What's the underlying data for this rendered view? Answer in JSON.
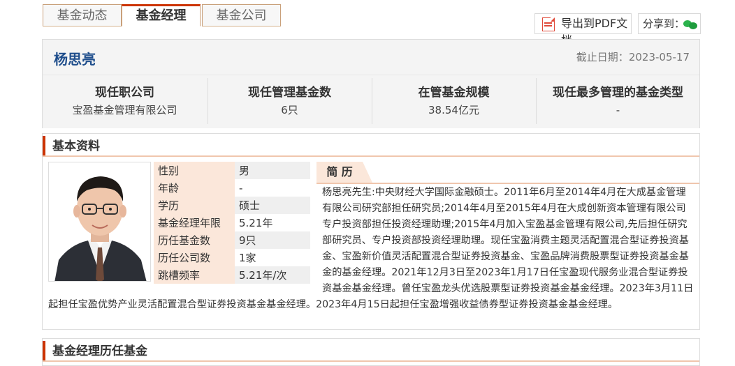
{
  "tabs": [
    {
      "label": "基金动态",
      "active": false
    },
    {
      "label": "基金经理",
      "active": true
    },
    {
      "label": "基金公司",
      "active": false
    }
  ],
  "toolbar": {
    "export_label": "导出到PDF文档",
    "share_label": "分享到：",
    "share_icon": "wechat-icon",
    "export_icon": "pdf-icon"
  },
  "manager": {
    "name": "杨思亮",
    "deadline_label": "截止日期：",
    "deadline": "2023-05-17"
  },
  "stats": [
    {
      "label": "现任职公司",
      "value": "宝盈基金管理有限公司"
    },
    {
      "label": "现任管理基金数",
      "value": "6只"
    },
    {
      "label": "在管基金规模",
      "value": "38.54亿元"
    },
    {
      "label": "现任最多管理的基金类型",
      "value": "-"
    }
  ],
  "basic_info": {
    "title": "基本资料",
    "attributes": [
      {
        "key": "性别",
        "value": "男"
      },
      {
        "key": "年龄",
        "value": "-"
      },
      {
        "key": "学历",
        "value": "硕士"
      },
      {
        "key": "基金经理年限",
        "value": "5.21年"
      },
      {
        "key": "历任基金数",
        "value": "9只"
      },
      {
        "key": "历任公司数",
        "value": "1家"
      },
      {
        "key": "跳槽频率",
        "value": "5.21年/次"
      }
    ],
    "resume_title": "简 历",
    "resume": "杨思亮先生:中央财经大学国际金融硕士。2011年6月至2014年4月在大成基金管理有限公司研究部担任研究员;2014年4月至2015年4月在大成创新资本管理有限公司专户投资部担任投资经理助理;2015年4月加入宝盈基金管理有限公司,先后担任研究部研究员、专户投资部投资经理助理。现任宝盈消费主题灵活配置混合型证券投资基金、宝盈新价值灵活配置混合型证券投资基金、宝盈品牌消费股票型证券投资基金基金的基金经理。2021年12月3日至2023年1月17日任宝盈现代服务业混合型证券投资基金基金经理。曾任宝盈龙头优选股票型证券投资基金基金经理。2023年3月11日起担任宝盈优势产业灵活配置混合型证券投资基金基金经理。2023年4月15日起担任宝盈增强收益债券型证券投资基金基金经理。"
  },
  "career": {
    "title": "基金经理历任基金"
  },
  "colors": {
    "accent": "#cc3300",
    "name_blue": "#1f4e8c",
    "label_bg": "#fbe7da"
  }
}
